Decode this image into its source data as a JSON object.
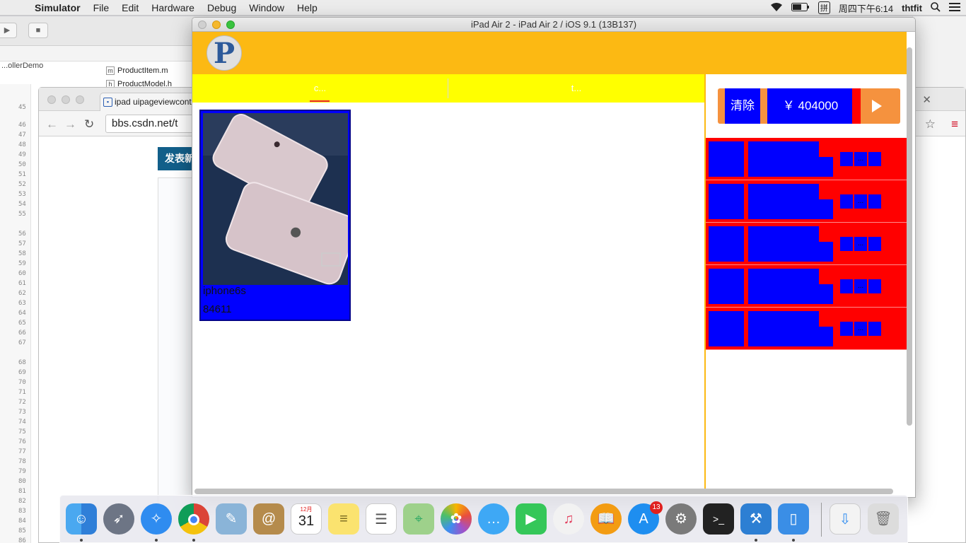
{
  "menubar": {
    "app_name": "Simulator",
    "items": [
      "File",
      "Edit",
      "Hardware",
      "Debug",
      "Window",
      "Help"
    ],
    "clock": "周四下午6:14",
    "ime": "拼",
    "user": "thtfit"
  },
  "xcode": {
    "breadcrumb": "...ollerDemo",
    "files": [
      "ProductItem.m",
      "ProductModel.h"
    ],
    "line_numbers": [
      "45",
      "46",
      "47",
      "48",
      "49",
      "50",
      "51",
      "52",
      "53",
      "54",
      "55",
      "56",
      "57",
      "58",
      "59",
      "60",
      "61",
      "62",
      "63",
      "64",
      "65",
      "66",
      "67",
      "68",
      "69",
      "70",
      "71",
      "72",
      "73",
      "74",
      "75",
      "76",
      "77",
      "78",
      "79",
      "80",
      "81",
      "82",
      "83",
      "84",
      "85",
      "86"
    ]
  },
  "chrome": {
    "tab_title": "ipad uipageviewcont",
    "url": "bbs.csdn.net/t",
    "post_button": "发表新"
  },
  "simulator": {
    "window_title": "iPad Air 2 - iPad Air 2 / iOS 9.1 (13B137)"
  },
  "app": {
    "logo_letter": "P",
    "tabs": [
      {
        "label": "c..."
      },
      {
        "label": "t..."
      }
    ],
    "products": [
      {
        "name": "iphone6s",
        "price": "84611"
      }
    ],
    "cart": {
      "clear_label": "清除",
      "total": "￥ 404000",
      "rows": [
        {
          "stepper": [
            "",
            "...",
            ""
          ]
        },
        {
          "stepper": [
            "",
            "...",
            ""
          ]
        },
        {
          "stepper": [
            "",
            "...",
            ""
          ]
        },
        {
          "stepper": [
            "",
            "...",
            ""
          ]
        },
        {
          "stepper": [
            "",
            "...",
            ""
          ]
        }
      ]
    },
    "colors": {
      "header": "#fcb913",
      "segment_bar": "#ffff00",
      "accent_blue": "#0000ff",
      "accent_red": "#ff0000",
      "checkout_orange": "#f5923e"
    }
  },
  "dock": {
    "apps": [
      "finder-icon",
      "launchpad-icon",
      "safari-icon",
      "chrome-icon",
      "preview-icon",
      "contacts-icon",
      "calendar-icon",
      "notes-icon",
      "reminders-icon",
      "maps-icon",
      "photos-icon",
      "messages-icon",
      "facetime-icon",
      "itunes-icon",
      "ibooks-icon",
      "app-store-icon",
      "system-preferences-icon",
      "terminal-icon",
      "xcode-icon",
      "simulator-icon",
      "downloads-stack-icon",
      "trash-icon"
    ],
    "calendar_month": "12月",
    "calendar_day": "31",
    "app_store_badge": "13"
  }
}
